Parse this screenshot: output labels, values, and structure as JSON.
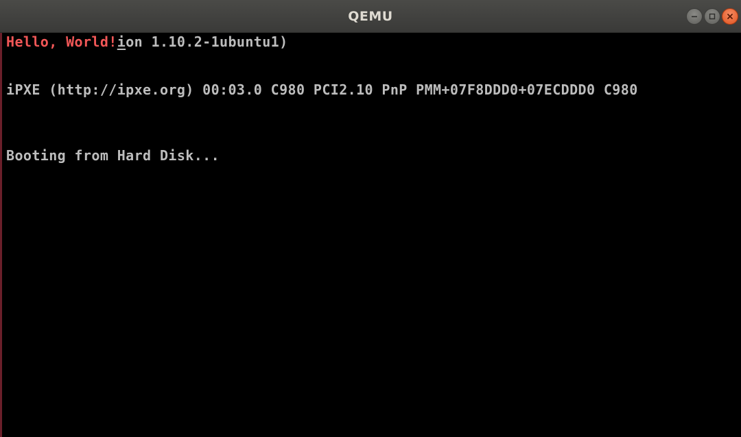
{
  "window": {
    "title": "QEMU",
    "controls": [
      "minimize-icon",
      "maximize-icon",
      "close-icon"
    ]
  },
  "terminal": {
    "line1_highlight": "Hello, World!",
    "line1_cursor_char": "i",
    "line1_rest": "on 1.10.2-1ubuntu1)",
    "line2": "iPXE (http://ipxe.org) 00:03.0 C980 PCI2.10 PnP PMM+07F8DDD0+07ECDDD0 C980",
    "line3": "Booting from Hard Disk..."
  },
  "colors": {
    "background": "#000000",
    "text": "#bdbdbd",
    "highlight_text": "#f25757",
    "titlebar": "#3a3a38",
    "close_button": "#e0541f"
  }
}
